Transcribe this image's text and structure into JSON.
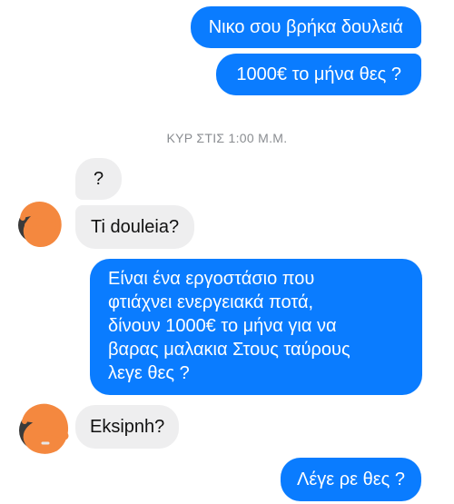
{
  "messages": [
    {
      "id": "m1",
      "direction": "outgoing",
      "text": "Νικο σου βρήκα δουλειά"
    },
    {
      "id": "m2",
      "direction": "outgoing",
      "text": "1000€ το μήνα θες ?"
    },
    {
      "id": "m3",
      "direction": "incoming",
      "text": "?"
    },
    {
      "id": "m4",
      "direction": "incoming",
      "text": "Ti douleia?"
    },
    {
      "id": "m5",
      "direction": "outgoing",
      "lines": [
        "Είναι ένα εργοστάσιο που",
        "φτιάχνει ενεργειακά ποτά,",
        "δίνουν 1000€ το μήνα για να",
        "βαρας μαλακια Στους ταύρους",
        "λεγε θες ?"
      ]
    },
    {
      "id": "m6",
      "direction": "incoming",
      "text": "Eksipnh?"
    },
    {
      "id": "m7",
      "direction": "outgoing",
      "text": "Λέγε ρε θες ?"
    }
  ],
  "timestamp": "ΚΥΡ ΣΤΙΣ 1:00 Μ.Μ.",
  "colors": {
    "outgoing_bubble": "#0a7cff",
    "incoming_bubble": "#eeeeef",
    "avatar_scribble": "#f4883f",
    "timestamp_text": "#8a8d91"
  },
  "icons": {
    "avatar": "contact-avatar-scribbled"
  }
}
